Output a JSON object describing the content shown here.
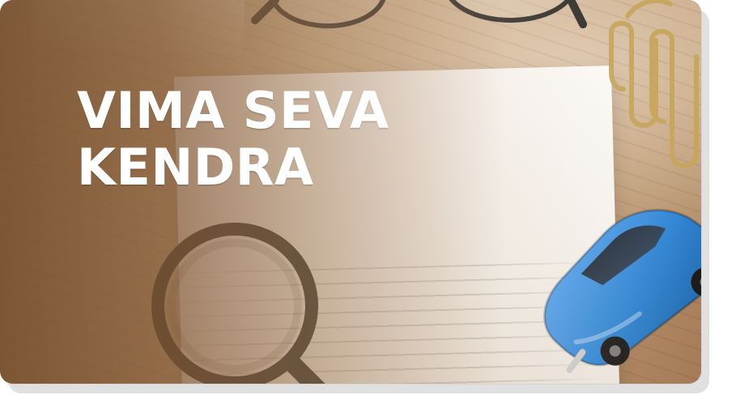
{
  "banner": {
    "title_line1": "VIMA SEVA",
    "title_line2": "KENDRA",
    "background_subject": "insurance-policy-desk-photo"
  },
  "colors": {
    "overlay_brown": "#8c5a30",
    "text_white": "#ffffff",
    "car_blue": "#2f86d6",
    "paperclip_gold": "#c7a65a"
  },
  "icons": {
    "magnifier": "magnifying-glass-icon",
    "glasses": "eyeglasses-icon",
    "car": "toy-car-icon",
    "paperclips": "paperclip-icon"
  }
}
